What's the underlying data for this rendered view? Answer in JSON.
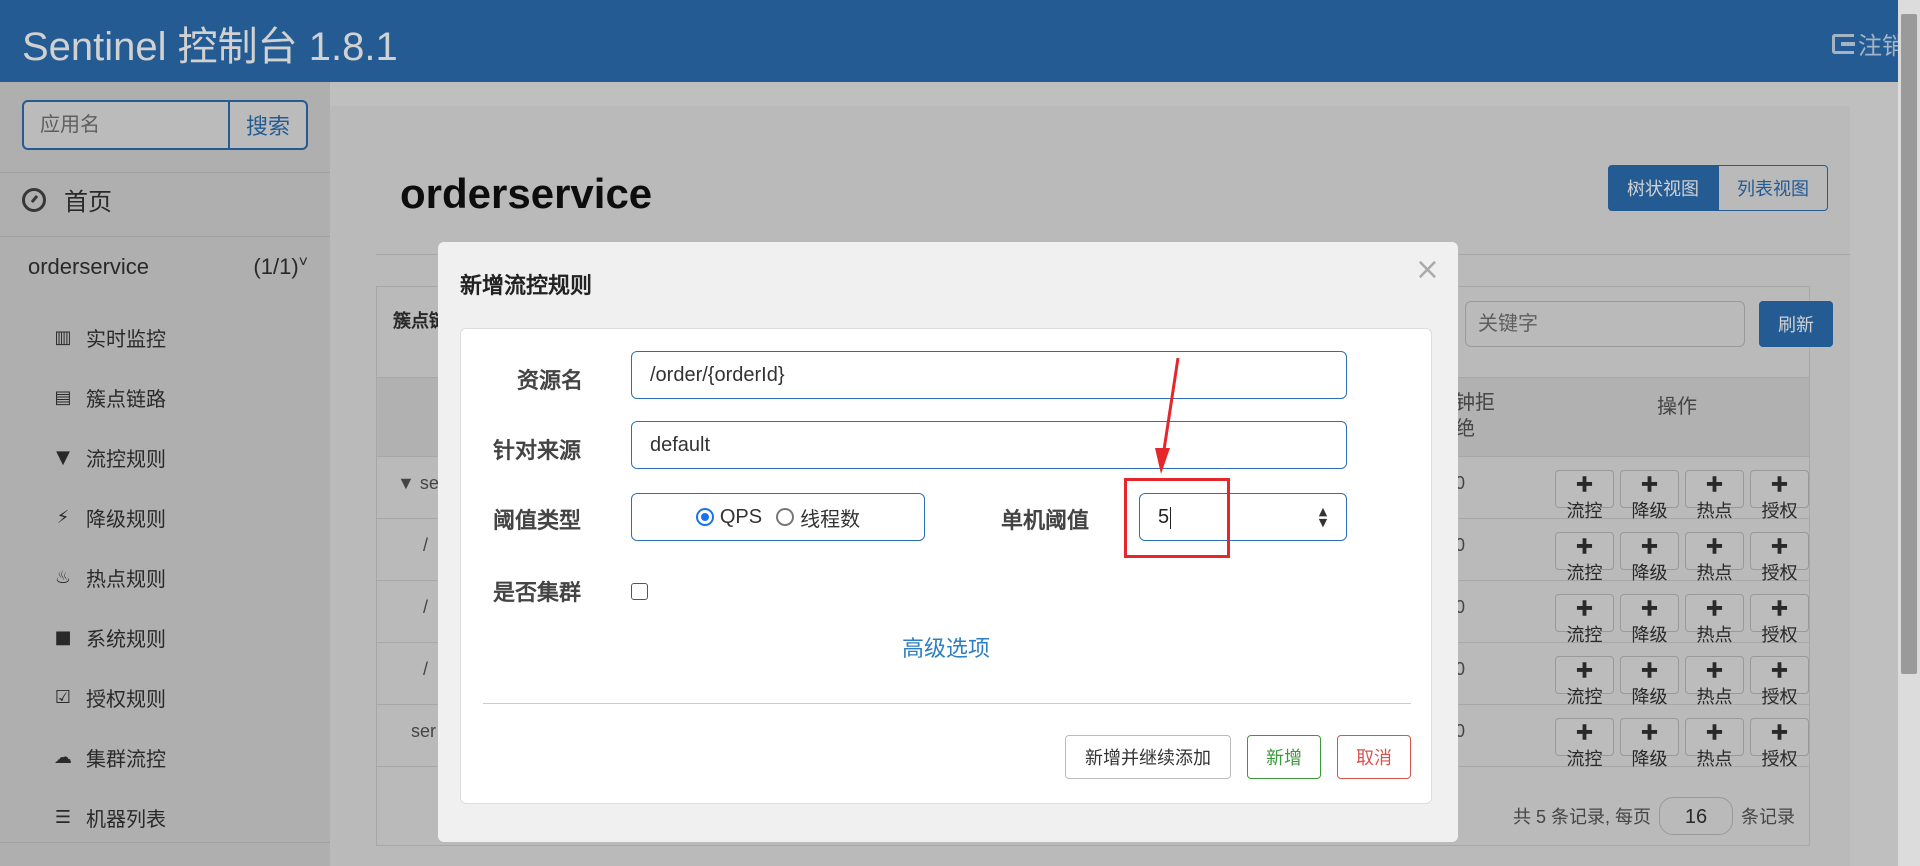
{
  "header": {
    "title": "Sentinel 控制台 1.8.1",
    "logout_label": "注销"
  },
  "sidebar": {
    "search_placeholder": "应用名",
    "search_button": "搜索",
    "home_label": "首页",
    "app": {
      "name": "orderservice",
      "count": "(1/1)"
    },
    "items": [
      {
        "icon": "bar-chart-icon",
        "glyph": "▥",
        "label": "实时监控"
      },
      {
        "icon": "list-icon",
        "glyph": "▤",
        "label": "簇点链路"
      },
      {
        "icon": "filter-icon",
        "glyph": "▼",
        "label": "流控规则"
      },
      {
        "icon": "bolt-icon",
        "glyph": "⚡",
        "label": "降级规则"
      },
      {
        "icon": "fire-icon",
        "glyph": "♨",
        "label": "热点规则"
      },
      {
        "icon": "lock-icon",
        "glyph": "■",
        "label": "系统规则"
      },
      {
        "icon": "check-icon",
        "glyph": "☑",
        "label": "授权规则"
      },
      {
        "icon": "cloud-icon",
        "glyph": "☁",
        "label": "集群流控"
      },
      {
        "icon": "th-list-icon",
        "glyph": "☰",
        "label": "机器列表"
      }
    ]
  },
  "main": {
    "page_title": "orderservice",
    "view_tree": "树状视图",
    "view_list": "列表视图",
    "card_label": "簇点链",
    "keyword_placeholder": "关键字",
    "refresh": "刷新",
    "col_deny": "钟拒绝",
    "col_ops": "操作",
    "rows": [
      {
        "name": "▼ se",
        "zero": "0"
      },
      {
        "name": "/",
        "zero": "0"
      },
      {
        "name": "/",
        "zero": "0"
      },
      {
        "name": "/",
        "zero": "0"
      },
      {
        "name": "ser",
        "zero": "0"
      }
    ],
    "op_labels": {
      "flow": "流控",
      "degrade": "降级",
      "hot": "热点",
      "auth": "授权"
    },
    "pager": {
      "prefix": "共 5 条记录, 每页",
      "page_size": "16",
      "suffix": "条记录"
    }
  },
  "modal": {
    "title": "新增流控规则",
    "close": "×",
    "resource_label": "资源名",
    "resource_value": "/order/{orderId}",
    "origin_label": "针对来源",
    "origin_value": "default",
    "grade_label": "阈值类型",
    "grade_qps": "QPS",
    "grade_thread": "线程数",
    "count_label": "单机阈值",
    "count_value": "5",
    "cluster_label": "是否集群",
    "advanced": "高级选项",
    "btn_continue": "新增并继续添加",
    "btn_add": "新增",
    "btn_cancel": "取消"
  },
  "colors": {
    "brand": "#2c6fb4",
    "highlight": "#e5262b",
    "success": "#3a9a3a",
    "danger": "#d9534f"
  }
}
